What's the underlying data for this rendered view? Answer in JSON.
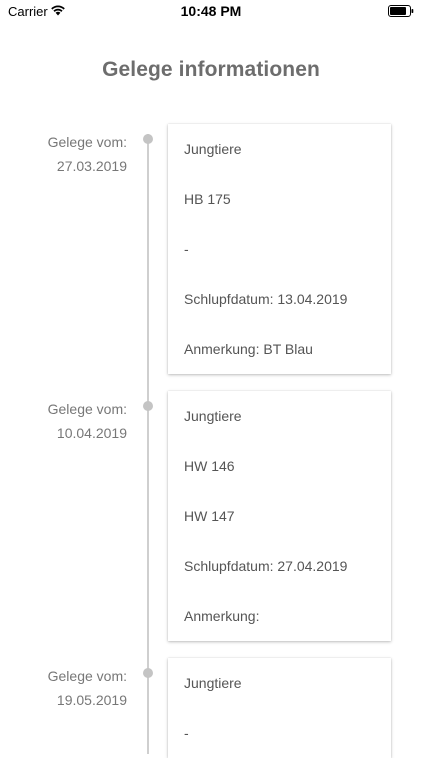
{
  "status_bar": {
    "carrier": "Carrier",
    "time": "10:48 PM"
  },
  "page_title": "Gelege informationen",
  "entries": [
    {
      "label_line1": "Gelege vom:",
      "label_line2": "27.03.2019",
      "rows": [
        "Jungtiere",
        "HB 175",
        "-",
        "Schlupfdatum: 13.04.2019",
        "Anmerkung: BT Blau"
      ]
    },
    {
      "label_line1": "Gelege vom:",
      "label_line2": "10.04.2019",
      "rows": [
        "Jungtiere",
        "HW 146",
        "HW 147",
        "Schlupfdatum: 27.04.2019",
        "Anmerkung:"
      ]
    },
    {
      "label_line1": "Gelege vom:",
      "label_line2": "19.05.2019",
      "rows": [
        "Jungtiere",
        "-"
      ]
    }
  ]
}
